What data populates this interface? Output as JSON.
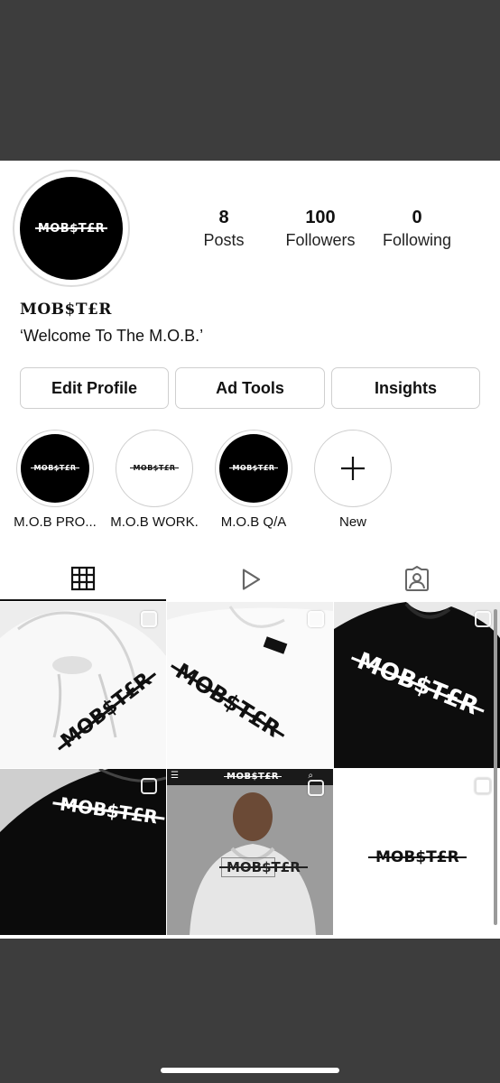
{
  "profile": {
    "avatar_logo": "MOB$T£R",
    "stats": [
      {
        "value": "8",
        "label": "Posts"
      },
      {
        "value": "100",
        "label": "Followers"
      },
      {
        "value": "0",
        "label": "Following"
      }
    ],
    "username": "MOB$T£R",
    "bio": "‘Welcome To The M.O.B.’"
  },
  "actions": {
    "edit_profile": "Edit Profile",
    "ad_tools": "Ad Tools",
    "insights": "Insights"
  },
  "highlights": [
    {
      "label": "M.O.B PRO...",
      "style": "black",
      "logo": "MOB$T£R"
    },
    {
      "label": "M.O.B WORK.",
      "style": "white",
      "logo": "MOB$T£R"
    },
    {
      "label": "M.O.B Q/A",
      "style": "black",
      "logo": "MOB$T£R"
    },
    {
      "label": "New",
      "icon": "plus-icon"
    }
  ],
  "tabs": [
    {
      "icon": "grid-icon",
      "active": true
    },
    {
      "icon": "reels-play-icon",
      "active": false
    },
    {
      "icon": "tagged-person-icon",
      "active": false
    }
  ],
  "posts": [
    {
      "logo": "MOB$T£R",
      "desc": "white hoodie"
    },
    {
      "logo": "MOB$T£R",
      "desc": "white tee"
    },
    {
      "logo": "MOB$T£R",
      "desc": "black tee"
    },
    {
      "logo": "MOB$T£R",
      "desc": "black hoodie"
    },
    {
      "logo": "MOB$T£R",
      "overlay_header": "MOB$T£R",
      "desc": "person in hoodie"
    },
    {
      "logo": "MOB$T£R",
      "desc": "logo on white"
    }
  ],
  "colors": {
    "sheet": "#ffffff",
    "frame": "#3d3d3d",
    "text": "#111111",
    "border": "#cfcfcf"
  }
}
